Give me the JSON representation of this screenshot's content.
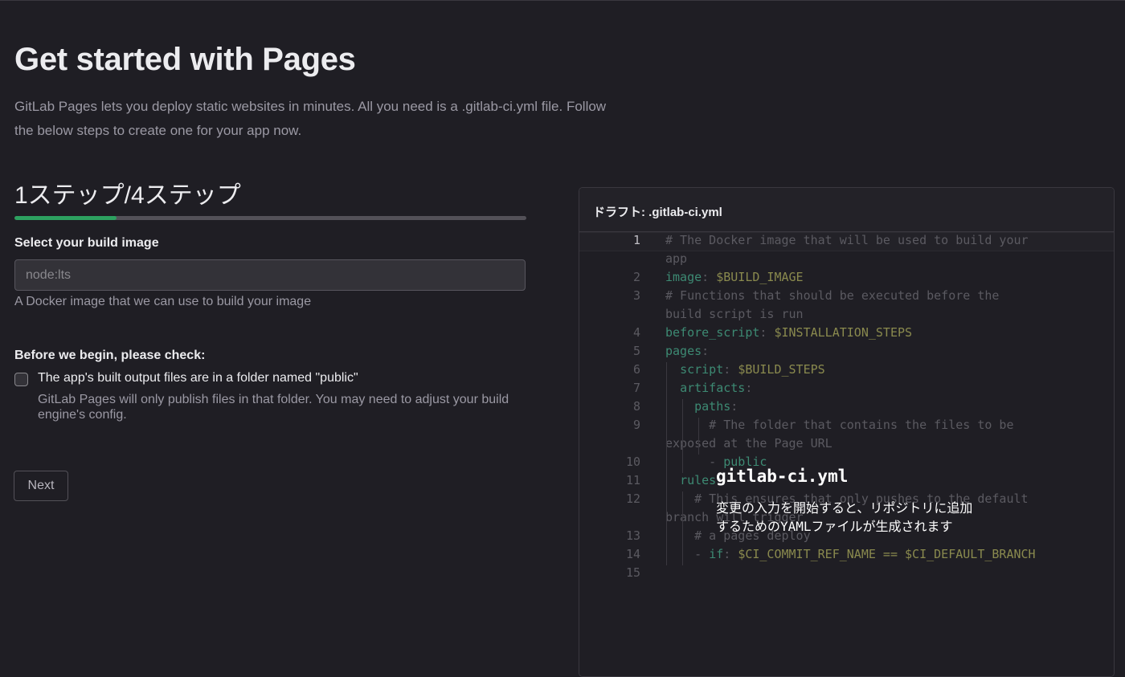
{
  "page": {
    "title": "Get started with Pages",
    "description": "GitLab Pages lets you deploy static websites in minutes. All you need is a .gitlab-ci.yml file. Follow the below steps to create one for your app now."
  },
  "wizard": {
    "step_title": "1ステップ/4ステップ",
    "progress": 0.2,
    "build_image_label": "Select your build image",
    "build_image_placeholder": "node:lts",
    "build_image_value": "",
    "build_image_help": "A Docker image that we can use to build your image",
    "check_heading": "Before we begin, please check:",
    "checkbox_label": "The app's built output files are in a folder named \"public\"",
    "checkbox_help": "GitLab Pages will only publish files in that folder. You may need to adjust your build engine's config.",
    "checkbox_checked": false,
    "next_label": "Next"
  },
  "editor": {
    "title": "ドラフト: .gitlab-ci.yml",
    "overlay_title": "gitlab-ci.yml",
    "overlay_body": "変更の入力を開始すると、リポジトリに追加するためのYAMLファイルが生成されます",
    "lines": [
      {
        "n": "1",
        "active": true,
        "segments": [
          {
            "t": "# The Docker image that will be used to build your",
            "c": "comment"
          }
        ]
      },
      {
        "n": "",
        "segments": [
          {
            "t": "app",
            "c": "comment"
          }
        ]
      },
      {
        "n": "2",
        "segments": [
          {
            "t": "image",
            "c": "kw"
          },
          {
            "t": ": ",
            "c": "plain"
          },
          {
            "t": "$BUILD_IMAGE",
            "c": "var"
          }
        ]
      },
      {
        "n": "3",
        "segments": [
          {
            "t": "# Functions that should be executed before the",
            "c": "comment"
          }
        ]
      },
      {
        "n": "",
        "segments": [
          {
            "t": "build script is run",
            "c": "comment"
          }
        ]
      },
      {
        "n": "4",
        "segments": [
          {
            "t": "before_script",
            "c": "kw"
          },
          {
            "t": ": ",
            "c": "plain"
          },
          {
            "t": "$INSTALLATION_STEPS",
            "c": "var"
          }
        ]
      },
      {
        "n": "5",
        "segments": [
          {
            "t": "pages",
            "c": "kw"
          },
          {
            "t": ":",
            "c": "plain"
          }
        ]
      },
      {
        "n": "6",
        "segments": [
          {
            "t": "  ",
            "c": "plain"
          },
          {
            "t": "script",
            "c": "kw"
          },
          {
            "t": ": ",
            "c": "plain"
          },
          {
            "t": "$BUILD_STEPS",
            "c": "var"
          }
        ]
      },
      {
        "n": "7",
        "segments": [
          {
            "t": "  ",
            "c": "plain"
          },
          {
            "t": "artifacts",
            "c": "kw"
          },
          {
            "t": ":",
            "c": "plain"
          }
        ]
      },
      {
        "n": "8",
        "segments": [
          {
            "t": "    ",
            "c": "plain"
          },
          {
            "t": "paths",
            "c": "kw"
          },
          {
            "t": ":",
            "c": "plain"
          }
        ]
      },
      {
        "n": "9",
        "segments": [
          {
            "t": "      # The folder that contains the files to be",
            "c": "comment"
          }
        ]
      },
      {
        "n": "",
        "segments": [
          {
            "t": "exposed at the Page URL",
            "c": "comment"
          }
        ]
      },
      {
        "n": "10",
        "segments": [
          {
            "t": "      - ",
            "c": "plain"
          },
          {
            "t": "public",
            "c": "kw"
          }
        ]
      },
      {
        "n": "11",
        "segments": [
          {
            "t": "  ",
            "c": "plain"
          },
          {
            "t": "rules",
            "c": "kw"
          },
          {
            "t": ":",
            "c": "plain"
          }
        ]
      },
      {
        "n": "12",
        "segments": [
          {
            "t": "    # This ensures that only pushes to the default",
            "c": "comment"
          }
        ]
      },
      {
        "n": "",
        "segments": [
          {
            "t": "branch will trigger",
            "c": "comment"
          }
        ]
      },
      {
        "n": "13",
        "segments": [
          {
            "t": "    # a pages deploy",
            "c": "comment"
          }
        ]
      },
      {
        "n": "14",
        "segments": [
          {
            "t": "    - ",
            "c": "plain"
          },
          {
            "t": "if",
            "c": "kw"
          },
          {
            "t": ": ",
            "c": "plain"
          },
          {
            "t": "$CI_COMMIT_REF_NAME == $CI_DEFAULT_BRANCH",
            "c": "var"
          }
        ]
      },
      {
        "n": "15",
        "segments": []
      }
    ]
  },
  "colors": {
    "background": "#1f1e24",
    "progress_fill": "#2da160",
    "keyword": "#3d8a73",
    "variable": "#8a8a4e"
  }
}
